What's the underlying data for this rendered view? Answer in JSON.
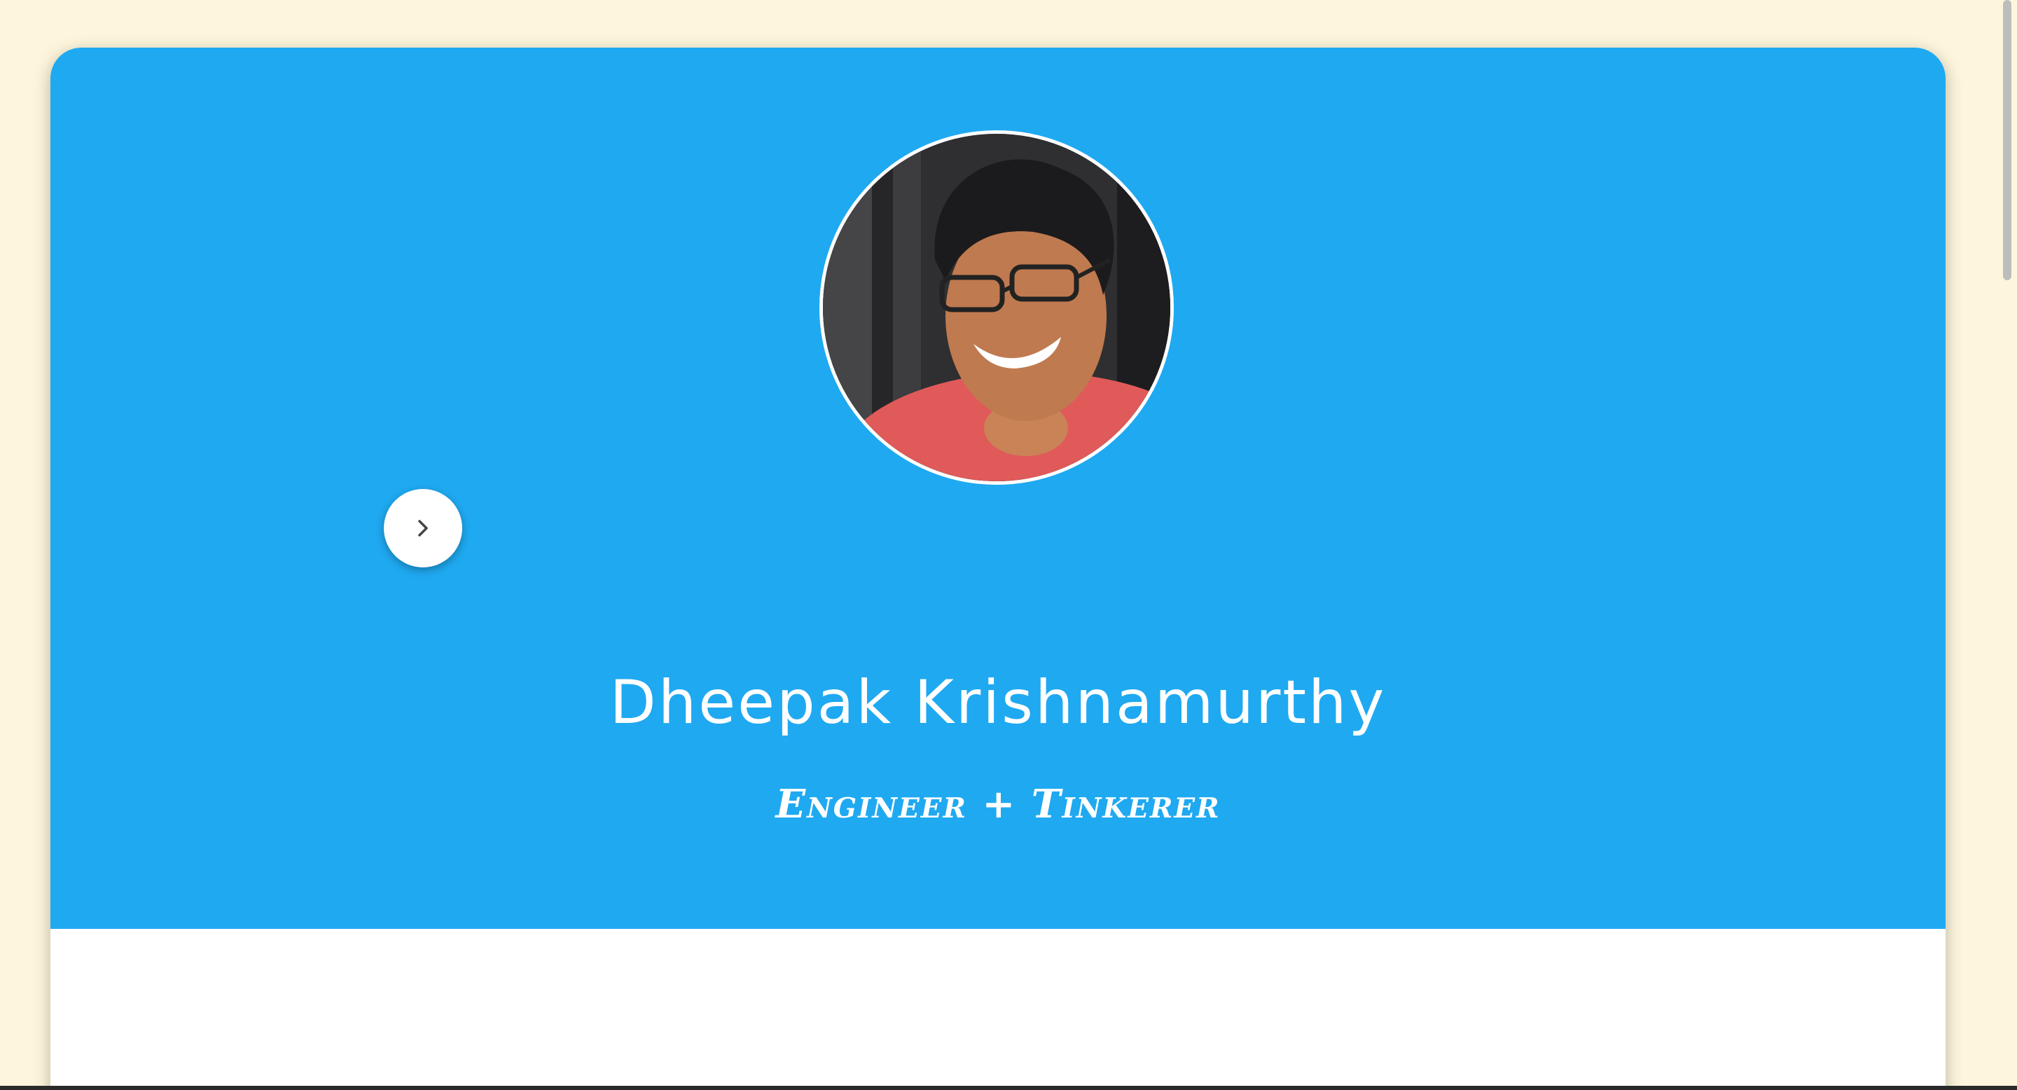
{
  "profile": {
    "name": "Dheepak Krishnamurthy",
    "tagline": "Engineer + Tinkerer",
    "avatar_icon": "profile-photo"
  },
  "controls": {
    "next_icon": "chevron-right-icon"
  },
  "colors": {
    "page_background": "#fdf6dc",
    "hero_background": "#1fa9f1",
    "card_background": "#ffffff",
    "text": "#ffffff"
  }
}
